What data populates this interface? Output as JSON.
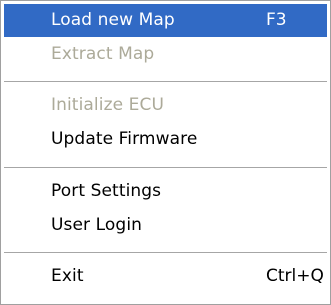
{
  "menu": {
    "items": [
      {
        "label": "Load new Map",
        "shortcut": "F3",
        "state": "selected"
      },
      {
        "label": "Extract Map",
        "shortcut": "",
        "state": "disabled"
      },
      {
        "label": "Initialize ECU",
        "shortcut": "",
        "state": "disabled"
      },
      {
        "label": "Update Firmware",
        "shortcut": "",
        "state": "enabled"
      },
      {
        "label": "Port Settings",
        "shortcut": "",
        "state": "enabled"
      },
      {
        "label": "User Login",
        "shortcut": "",
        "state": "enabled"
      },
      {
        "label": "Exit",
        "shortcut": "Ctrl+Q",
        "state": "enabled"
      }
    ]
  },
  "colors": {
    "highlight": "#316ac5",
    "highlight_text": "#ffffff",
    "disabled_text": "#acaa99",
    "text": "#000000",
    "separator": "#a6a6a6"
  }
}
